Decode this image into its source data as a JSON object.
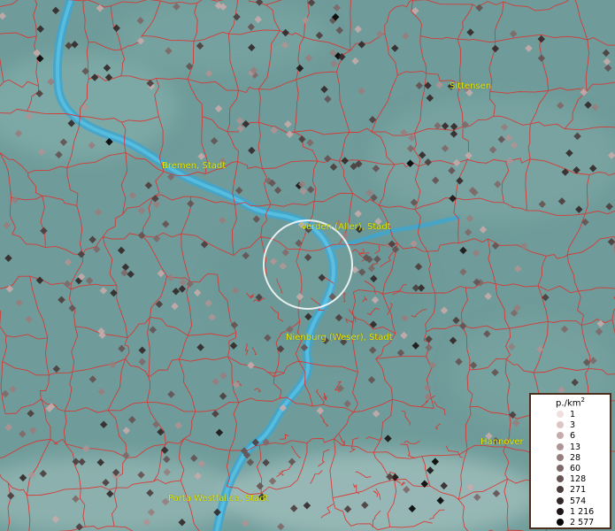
{
  "map": {
    "background": "#6f9c9a",
    "river_color": "#3fa6cf",
    "boundary_color": "#e0302c",
    "label_color": "#e8e800",
    "place_labels": [
      {
        "id": "sittensen",
        "text": "Sittensen"
      },
      {
        "id": "bremen",
        "text": "Bremen, Stadt"
      },
      {
        "id": "verden",
        "text": "Verden (Aller), Stadt"
      },
      {
        "id": "nienburg",
        "text": "Nienburg (Weser), Stadt"
      },
      {
        "id": "hannover",
        "text": "Hannover"
      },
      {
        "id": "porta",
        "text": "Porta Westfalica, Stadt"
      }
    ]
  },
  "legend": {
    "title": "p./km",
    "title_sup": "2",
    "entries": [
      {
        "label": "1",
        "color": "#f1dede"
      },
      {
        "label": "3",
        "color": "#dcc4c4"
      },
      {
        "label": "6",
        "color": "#c6abab"
      },
      {
        "label": "13",
        "color": "#ae9494"
      },
      {
        "label": "28",
        "color": "#977e7e"
      },
      {
        "label": "60",
        "color": "#7e6868"
      },
      {
        "label": "128",
        "color": "#655252"
      },
      {
        "label": "271",
        "color": "#4c3d3d"
      },
      {
        "label": "574",
        "color": "#332828"
      },
      {
        "label": "1 216",
        "color": "#1b1515"
      },
      {
        "label": "2 577",
        "color": "#050303"
      }
    ]
  }
}
